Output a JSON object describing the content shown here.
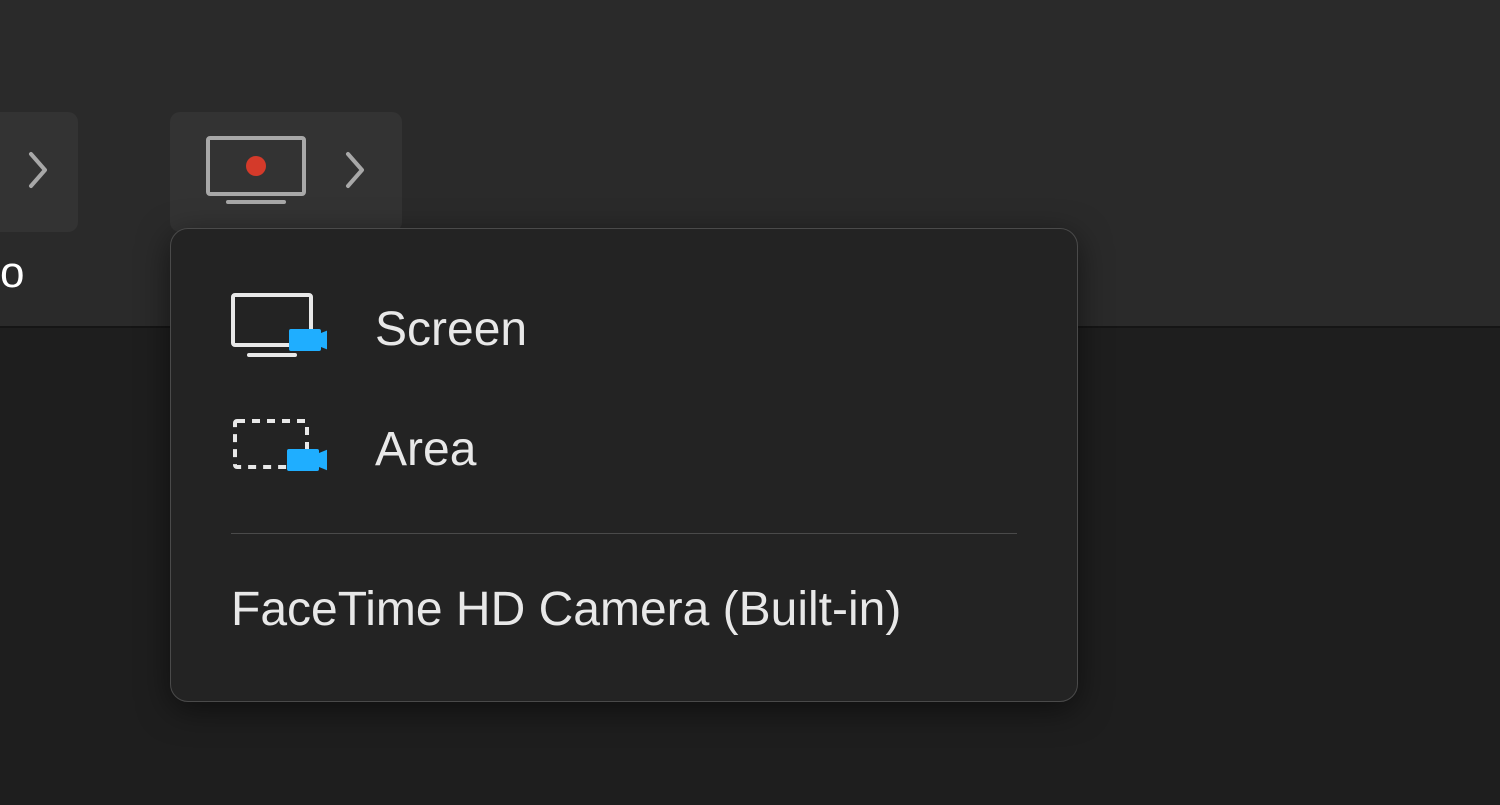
{
  "toolbar": {
    "partial_label": "o"
  },
  "menu": {
    "items": [
      {
        "label": "Screen"
      },
      {
        "label": "Area"
      }
    ],
    "camera_label": "FaceTime HD Camera (Built-in)"
  },
  "colors": {
    "accent_blue": "#1faeff",
    "record_red": "#d43a2a",
    "bg_dark": "#1e1e1e",
    "bg_toolbar": "#2a2a2a",
    "bg_button": "#333333",
    "bg_menu": "#232323",
    "text": "#e8e8e8",
    "border": "#4a4a4a"
  }
}
